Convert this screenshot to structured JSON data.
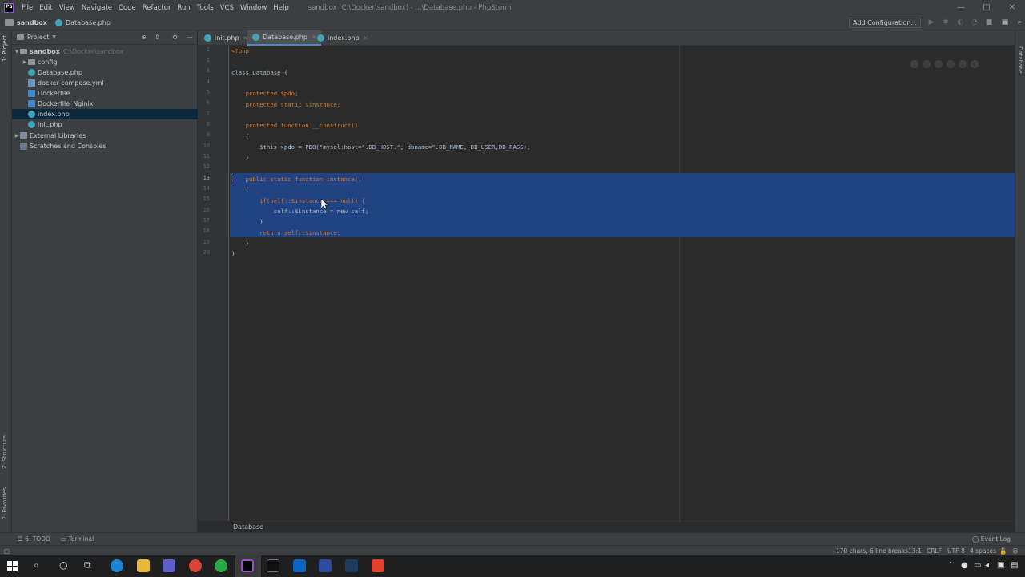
{
  "menubar": {
    "items": [
      "File",
      "Edit",
      "View",
      "Navigate",
      "Code",
      "Refactor",
      "Run",
      "Tools",
      "VCS",
      "Window",
      "Help"
    ],
    "window_title": "sandbox [C:\\Docker\\sandbox] - ...\\Database.php - PhpStorm"
  },
  "navbar": {
    "project": "sandbox",
    "file": "Database.php",
    "config_button": "Add Configuration..."
  },
  "left_strip": {
    "project": "1: Project",
    "structure": "Z: Structure",
    "favorites": "2: Favorites"
  },
  "right_strip": {
    "database": "Database"
  },
  "project_panel": {
    "title": "Project",
    "root": {
      "name": "sandbox",
      "path": "C:\\Docker\\sandbox"
    },
    "items": [
      {
        "label": "config",
        "type": "dir"
      },
      {
        "label": "Database.php",
        "type": "php"
      },
      {
        "label": "docker-compose.yml",
        "type": "yml"
      },
      {
        "label": "Dockerfile",
        "type": "dock"
      },
      {
        "label": "Dockerfile_Nginix",
        "type": "dock"
      },
      {
        "label": "index.php",
        "type": "php"
      },
      {
        "label": "init.php",
        "type": "php"
      }
    ],
    "external_libraries": "External Libraries",
    "scratches": "Scratches and Consoles"
  },
  "tabs": [
    {
      "label": "init.php",
      "active": false
    },
    {
      "label": "Database.php",
      "active": true
    },
    {
      "label": "index.php",
      "active": false
    }
  ],
  "editor": {
    "line_numbers": [
      "1",
      "2",
      "3",
      "4",
      "5",
      "6",
      "7",
      "8",
      "9",
      "10",
      "11",
      "12",
      "13",
      "14",
      "15",
      "16",
      "17",
      "18",
      "19",
      "20"
    ],
    "lines": [
      "<?php",
      "",
      "class Database {",
      "",
      "    protected $pdo;",
      "    protected static $instance;",
      "",
      "    protected function __construct()",
      "    {",
      "        $this->pdo = PDO(\"mysql:host=\".DB_HOST.\"; dbname=\".DB_NAME, DB_USER,DB_PASS);",
      "    }",
      "",
      "    public static function instance()",
      "    {",
      "        if(self::$instance === null) {",
      "            self::$instance = new self;",
      "        }",
      "        return self::$instance;",
      "    }",
      "}"
    ],
    "breadcrumb": "Database"
  },
  "toolwindows": {
    "todo": "6: TODO",
    "terminal": "Terminal",
    "event_log": "Event Log"
  },
  "statusbar": {
    "selection": "170 chars, 6 line breaks",
    "position": "13:1",
    "line_sep": "CRLF",
    "encoding": "UTF-8",
    "indent": "4 spaces"
  }
}
